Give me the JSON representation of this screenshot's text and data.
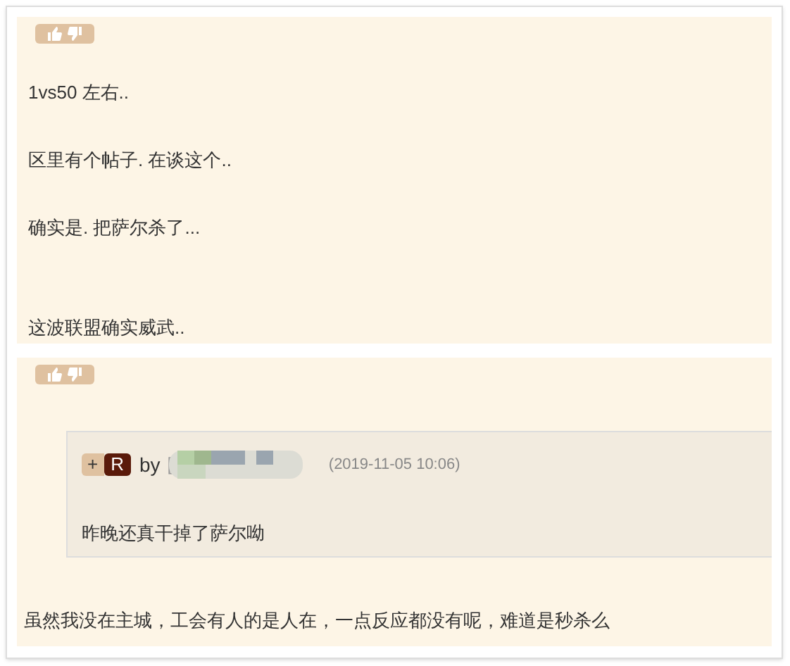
{
  "posts": [
    {
      "paragraphs": [
        "1vs50 左右..",
        "区里有个帖子. 在谈这个..",
        "确实是. 把萨尔杀了...",
        "这波联盟确实威武.."
      ]
    },
    {
      "quote": {
        "plus": "+",
        "badge": "R",
        "by": "by",
        "bracket": "[",
        "time": "(2019-11-05 10:06)",
        "text": "昨晚还真干掉了萨尔呦"
      },
      "paragraphs": [
        "虽然我没在主城，工会有人的是人在，一点反应都没有呢，难道是秒杀么"
      ]
    }
  ]
}
